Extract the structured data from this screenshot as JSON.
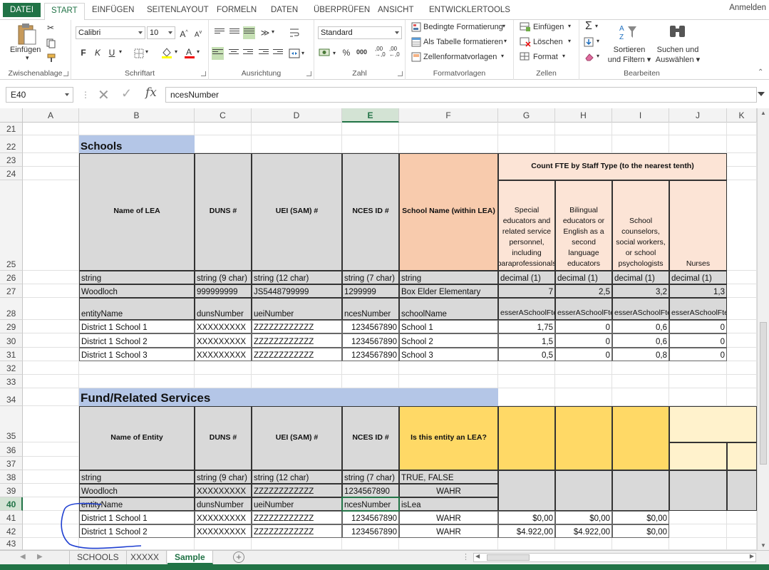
{
  "ribbon_tabs": [
    "DATEI",
    "START",
    "EINFÜGEN",
    "SEITENLAYOUT",
    "FORMELN",
    "DATEN",
    "ÜBERPRÜFEN",
    "ANSICHT",
    "ENTWICKLERTOOLS"
  ],
  "signin": "Anmelden",
  "groups": {
    "clipboard": {
      "label": "Zwischenablage",
      "paste": "Einfügen"
    },
    "font": {
      "label": "Schriftart",
      "font_name": "Calibri",
      "font_size": "10",
      "bold": "F",
      "italic": "K",
      "underline": "U"
    },
    "alignment": {
      "label": "Ausrichtung"
    },
    "number": {
      "label": "Zahl",
      "format": "Standard",
      "percent": "%",
      "thousands": "000"
    },
    "styles": {
      "label": "Formatvorlagen",
      "cond": "Bedingte Formatierung",
      "table": "Als Tabelle formatieren",
      "cell": "Zellenformatvorlagen"
    },
    "cells": {
      "label": "Zellen",
      "insert": "Einfügen",
      "delete": "Löschen",
      "format": "Format"
    },
    "editing": {
      "label": "Bearbeiten",
      "sort": "Sortieren und Filtern",
      "find": "Suchen und Auswählen"
    }
  },
  "formula_bar": {
    "name_box": "E40",
    "formula": "ncesNumber"
  },
  "columns": [
    "A",
    "B",
    "C",
    "D",
    "E",
    "F",
    "G",
    "H",
    "I",
    "J",
    "K"
  ],
  "selected_column": "E",
  "selected_row": "40",
  "rows": [
    "21",
    "22",
    "23",
    "24",
    "25",
    "26",
    "27",
    "28",
    "29",
    "30",
    "31",
    "32",
    "33",
    "34",
    "35",
    "36",
    "37",
    "38",
    "39",
    "40",
    "41",
    "42",
    "43"
  ],
  "schools": {
    "title": "Schools",
    "headers": [
      "Name of LEA",
      "DUNS #",
      "UEI (SAM) #",
      "NCES ID #",
      "School Name (within LEA)"
    ],
    "fte_header": "Count FTE by Staff Type (to the nearest tenth)",
    "fte_cols": [
      "Special educators and related service personnel, including paraprofessionals",
      "Bilingual educators or English as a second language educators",
      "School counselors, social workers, or school psychologists",
      "Nurses"
    ],
    "types": [
      "string",
      "string (9 char)",
      "string (12 char)",
      "string (7 char)",
      "string",
      "decimal (1)",
      "decimal (1)",
      "decimal (1)",
      "decimal (1)"
    ],
    "example": [
      "Woodloch",
      "999999999",
      "JS5448799999",
      "1299999",
      "Box Elder Elementary",
      "7",
      "2,5",
      "3,2",
      "1,3"
    ],
    "fields": [
      "entityName",
      "dunsNumber",
      "ueiNumber",
      "ncesNumber",
      "schoolName",
      "esserASchoolFteSpecialEd",
      "esserASchoolFteBilingual",
      "esserASchoolFteCounselors",
      "esserASchoolFteNurses"
    ],
    "data": [
      [
        "District 1 School 1",
        "XXXXXXXXX",
        "ZZZZZZZZZZZZ",
        "1234567890",
        "School 1",
        "1,75",
        "0",
        "0,6",
        "0"
      ],
      [
        "District 1 School 2",
        "XXXXXXXXX",
        "ZZZZZZZZZZZZ",
        "1234567890",
        "School 2",
        "1,5",
        "0",
        "0,6",
        "0"
      ],
      [
        "District 1 School 3",
        "XXXXXXXXX",
        "ZZZZZZZZZZZZ",
        "1234567890",
        "School 3",
        "0,5",
        "0",
        "0,8",
        "0"
      ]
    ]
  },
  "fund": {
    "title": "Fund/Related Services",
    "headers": [
      "Name of Entity",
      "DUNS #",
      "UEI (SAM) #",
      "NCES ID #",
      "Is this entity an LEA?"
    ],
    "types": [
      "string",
      "string (9 char)",
      "string (12 char)",
      "string (7 char)",
      "TRUE, FALSE"
    ],
    "example": [
      "Woodloch",
      "XXXXXXXXX",
      "ZZZZZZZZZZZZ",
      "1234567890",
      "WAHR"
    ],
    "fields": [
      "entityName",
      "dunsNumber",
      "ueiNumber",
      "ncesNumber",
      "isLea"
    ],
    "data": [
      [
        "District 1 School 1",
        "XXXXXXXXX",
        "ZZZZZZZZZZZZ",
        "1234567890",
        "WAHR",
        "$0,00",
        "$0,00",
        "$0,00"
      ],
      [
        "District 1 School 2",
        "XXXXXXXXX",
        "ZZZZZZZZZZZZ",
        "1234567890",
        "WAHR",
        "$4.922,00",
        "$4.922,00",
        "$0,00"
      ]
    ]
  },
  "sheets": [
    "SCHOOLS",
    "XXXXX",
    "Sample"
  ],
  "active_sheet": "Sample",
  "colors": {
    "accent": "#217346",
    "title_blue": "#b4c6e7",
    "header_gray": "#d9d9d9",
    "salmon": "#f8cbad",
    "peach": "#fce4d6",
    "gold": "#ffd966",
    "light_gold": "#fff2cc"
  }
}
